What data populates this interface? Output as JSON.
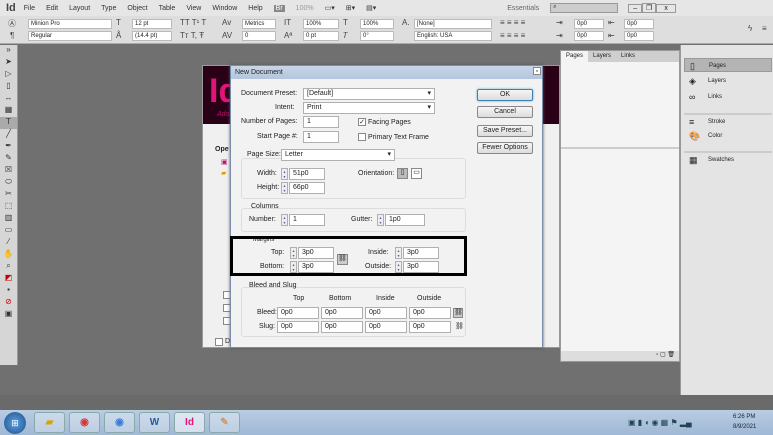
{
  "app": {
    "logo": "Id",
    "menu": [
      "File",
      "Edit",
      "Layout",
      "Type",
      "Object",
      "Table",
      "View",
      "Window",
      "Help"
    ],
    "zoom": "100%",
    "workspace": "Essentials",
    "search_placeholder": ""
  },
  "control": {
    "font": "Minion Pro",
    "style": "Regular",
    "size": "12 pt",
    "leading": "(14.4 pt)",
    "kerning": "Metrics",
    "tracking": "0",
    "vscale": "100%",
    "hscale": "100%",
    "baseline": "0 pt",
    "skew": "0°",
    "char_style": "[None]",
    "language": "English: USA",
    "indent1": "0p0",
    "indent2": "0p0",
    "indent3": "0p0",
    "indent4": "0p0"
  },
  "welcome": {
    "logo": "Id",
    "subtitle": "Adobe",
    "open_label": "Ope",
    "dont_show": "D"
  },
  "dialog": {
    "title": "New Document",
    "preset_label": "Document Preset:",
    "preset": "[Default]",
    "intent_label": "Intent:",
    "intent": "Print",
    "pages_label": "Number of Pages:",
    "pages": "1",
    "start_label": "Start Page #:",
    "start": "1",
    "facing": "Facing Pages",
    "primary": "Primary Text Frame",
    "size_label": "Page Size:",
    "size": "Letter",
    "width_label": "Width:",
    "width": "51p0",
    "height_label": "Height:",
    "height": "66p0",
    "orientation_label": "Orientation:",
    "columns_title": "Columns",
    "number_label": "Number:",
    "number": "1",
    "gutter_label": "Gutter:",
    "gutter": "1p0",
    "margins_title": "Margins",
    "top_label": "Top:",
    "top": "3p0",
    "bottom_label": "Bottom:",
    "bottom": "3p0",
    "inside_label": "Inside:",
    "inside": "3p0",
    "outside_label": "Outside:",
    "outside": "3p0",
    "bleed_title": "Bleed and Slug",
    "col_headers": [
      "Top",
      "Bottom",
      "Inside",
      "Outside"
    ],
    "bleed_label": "Bleed:",
    "bleed": [
      "0p0",
      "0p0",
      "0p0",
      "0p0"
    ],
    "slug_label": "Slug:",
    "slug": [
      "0p0",
      "0p0",
      "0p0",
      "0p0"
    ],
    "ok": "OK",
    "cancel": "Cancel",
    "save_preset": "Save Preset...",
    "fewer": "Fewer Options"
  },
  "pages_panel": {
    "tabs": [
      "Pages",
      "Layers",
      "Links"
    ]
  },
  "dock": [
    "Pages",
    "Layers",
    "Links",
    "Stroke",
    "Color",
    "Swatches"
  ],
  "taskbar": {
    "time": "6:26 PM",
    "date": "8/9/2021",
    "apps": [
      "Explorer",
      "Chrome",
      "Chrome Canary",
      "Word",
      "InDesign",
      "Paint"
    ]
  }
}
